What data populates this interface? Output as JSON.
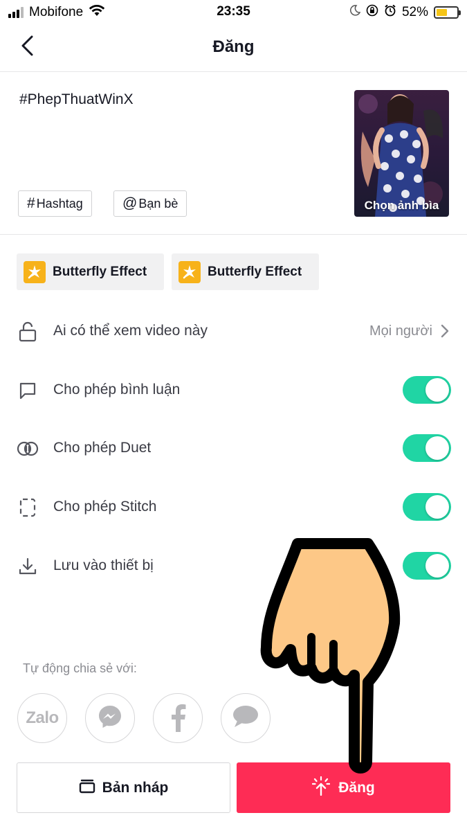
{
  "status_bar": {
    "carrier": "Mobifone",
    "time": "23:35",
    "battery_percent": "52%",
    "battery_level": 0.52,
    "icons": [
      "signal-icon",
      "wifi-icon",
      "moon-icon",
      "orientation-lock-icon",
      "alarm-icon",
      "battery-icon"
    ]
  },
  "nav": {
    "title": "Đăng",
    "back_icon": "chevron-left-icon"
  },
  "caption": {
    "text": "#PhepThuatWinX",
    "hashtag_button": {
      "symbol": "#",
      "label": "Hashtag"
    },
    "friends_button": {
      "symbol": "@",
      "label": "Bạn bè"
    },
    "cover_label": "Chọn ảnh bìa"
  },
  "effects": [
    {
      "label": "Butterfly Effect",
      "icon": "sparkle-icon"
    },
    {
      "label": "Butterfly Effect",
      "icon": "sparkle-icon"
    }
  ],
  "settings": {
    "privacy": {
      "label": "Ai có thể xem video này",
      "value": "Mọi người",
      "icon": "unlock-icon"
    },
    "comments": {
      "label": "Cho phép bình luận",
      "enabled": true,
      "icon": "comment-icon"
    },
    "duet": {
      "label": "Cho phép Duet",
      "enabled": true,
      "icon": "duet-icon"
    },
    "stitch": {
      "label": "Cho phép Stitch",
      "enabled": true,
      "icon": "stitch-icon"
    },
    "save": {
      "label": "Lưu vào thiết bị",
      "enabled": true,
      "icon": "download-icon"
    }
  },
  "share": {
    "label": "Tự động chia sẻ với:",
    "zalo_text": "Zalo",
    "targets": [
      "zalo-icon",
      "messenger-icon",
      "facebook-icon",
      "message-icon"
    ]
  },
  "buttons": {
    "draft_label": "Bản nháp",
    "post_label": "Đăng"
  },
  "colors": {
    "accent": "#fe2c55",
    "toggle_on": "#20d5a4",
    "effect_icon": "#f7b21a",
    "muted_text": "#8a8b91"
  }
}
